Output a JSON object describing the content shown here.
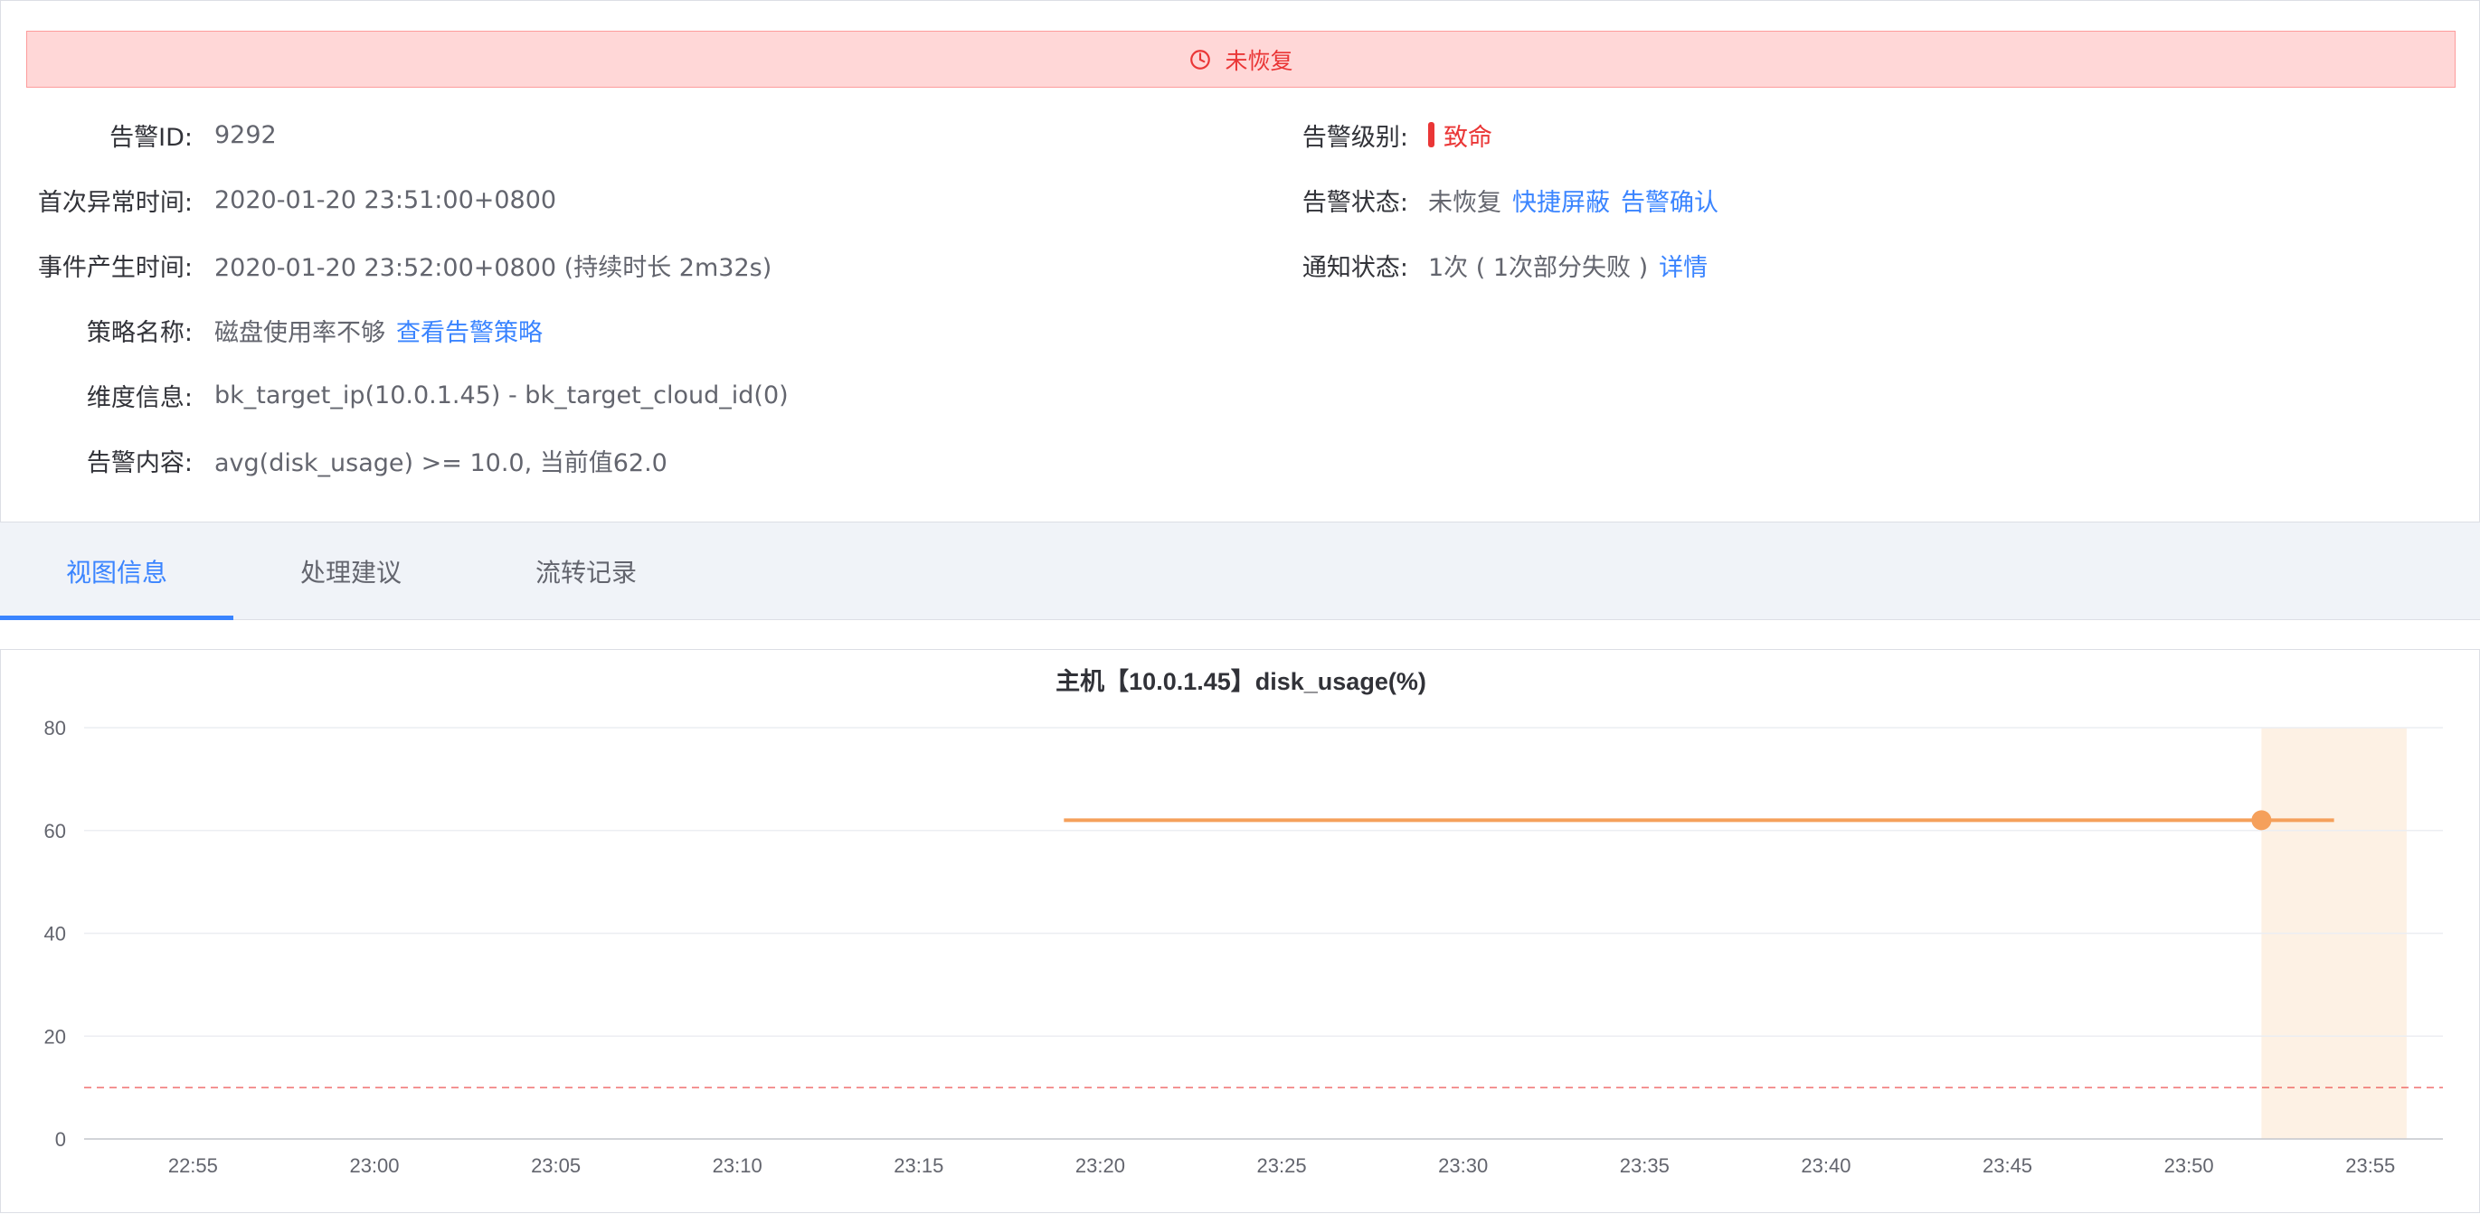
{
  "status_banner": {
    "text": "未恢复",
    "icon": "clock-icon",
    "color": "#ea3636"
  },
  "details": {
    "alert_id": {
      "label": "告警ID:",
      "value": "9292"
    },
    "first_time": {
      "label": "首次异常时间:",
      "value": "2020-01-20 23:51:00+0800"
    },
    "event_time": {
      "label": "事件产生时间:",
      "value": "2020-01-20 23:52:00+0800 (持续时长 2m32s)"
    },
    "strategy": {
      "label": "策略名称:",
      "value": "磁盘使用率不够",
      "link": "查看告警策略"
    },
    "dimension": {
      "label": "维度信息:",
      "value": "bk_target_ip(10.0.1.45) - bk_target_cloud_id(0)"
    },
    "content": {
      "label": "告警内容:",
      "value": "avg(disk_usage) >= 10.0, 当前值62.0"
    },
    "level": {
      "label": "告警级别:",
      "value": "致命",
      "color": "#ea3636"
    },
    "alert_status": {
      "label": "告警状态:",
      "value": "未恢复",
      "link_shield": "快捷屏蔽",
      "link_confirm": "告警确认"
    },
    "notify_status": {
      "label": "通知状态:",
      "value": "1次 ( 1次部分失败 )",
      "link": "详情"
    }
  },
  "tabs": [
    {
      "label": "视图信息",
      "active": true
    },
    {
      "label": "处理建议",
      "active": false
    },
    {
      "label": "流转记录",
      "active": false
    }
  ],
  "chart_data": {
    "type": "line",
    "title": "主机【10.0.1.45】disk_usage(%)",
    "x_ticks": [
      "22:55",
      "23:00",
      "23:05",
      "23:10",
      "23:15",
      "23:20",
      "23:25",
      "23:30",
      "23:35",
      "23:40",
      "23:45",
      "23:50",
      "23:55"
    ],
    "y_ticks": [
      "0",
      "20",
      "40",
      "60",
      "80"
    ],
    "xlim": [
      "22:52",
      "23:57"
    ],
    "ylim": [
      0,
      80
    ],
    "series": [
      {
        "color": "#f5a05b",
        "points": [
          {
            "x": "23:19",
            "y": 62
          },
          {
            "x": "23:54",
            "y": 62
          }
        ]
      }
    ],
    "marker": {
      "x": "23:52",
      "y": 62
    },
    "threshold": {
      "y": 10,
      "color": "#ea3636",
      "style": "dashed"
    },
    "highlight_range": [
      "23:52",
      "23:56"
    ],
    "grid": true
  }
}
